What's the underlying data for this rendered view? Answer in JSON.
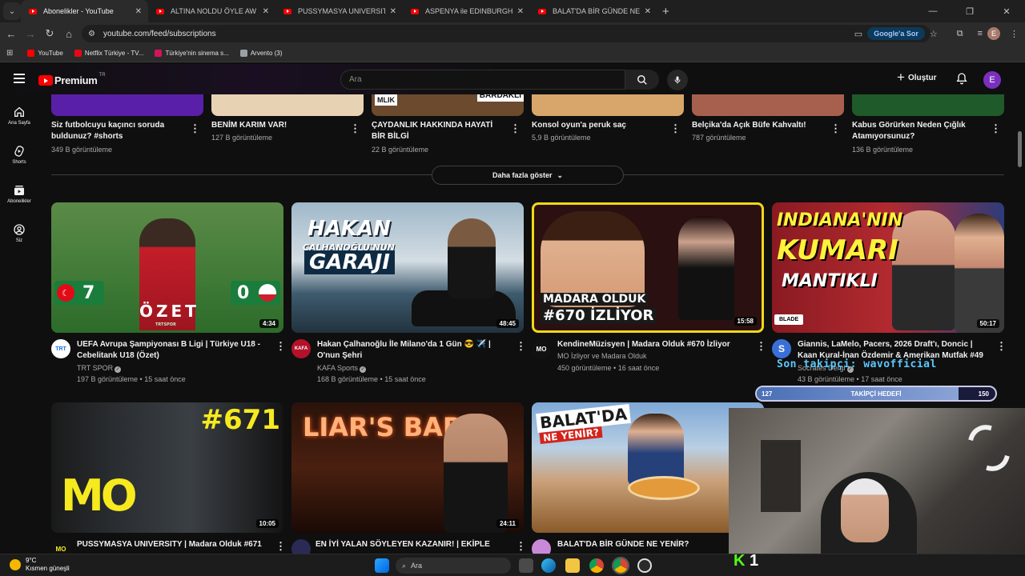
{
  "browser": {
    "tabs": [
      {
        "label": "Abonelikler - YouTube",
        "active": true
      },
      {
        "label": "ALTINA NOLDU ÖYLE AW | Kan",
        "active": false
      },
      {
        "label": "PUSSYMASYA UNIVERSITY | Ma",
        "active": false
      },
      {
        "label": "ASPENYA ile EDINBURGH YEME",
        "active": false
      },
      {
        "label": "BALAT'DA BİR GÜNDE NE YENİR",
        "active": false
      }
    ],
    "url": "youtube.com/feed/subscriptions",
    "google_sor_label": "Google'a Sor",
    "profile_initial": "E",
    "bookmarks": [
      {
        "label": "YouTube",
        "color": "#ff0000"
      },
      {
        "label": "Netflix Türkiye - TV...",
        "color": "#e50914"
      },
      {
        "label": "Türkiye'nin sinema s...",
        "color": "#d4145a"
      },
      {
        "label": "Arvento (3)",
        "color": "#9aa0a6"
      }
    ]
  },
  "youtube": {
    "logo_text": "Premium",
    "logo_region": "TR",
    "search_placeholder": "Ara",
    "create_label": "Oluştur",
    "avatar_initial": "E",
    "sidebar": [
      {
        "label": "Ana Sayfa",
        "icon": "home-icon"
      },
      {
        "label": "Shorts",
        "icon": "shorts-icon"
      },
      {
        "label": "Abonelikler",
        "icon": "subscriptions-icon"
      },
      {
        "label": "Siz",
        "icon": "you-icon"
      }
    ],
    "shorts": [
      {
        "title": "Siz futbolcuyu kaçıncı soruda buldunuz? #shorts",
        "views": "349 B görüntüleme",
        "color": "#5a1fa8"
      },
      {
        "title": "BENİM KARIM VAR!",
        "views": "127 B görüntüleme",
        "color": "#e8d2b4"
      },
      {
        "title": "ÇAYDANLIK HAKKINDA HAYATİ BİR BİLGİ",
        "views": "22 B görüntüleme",
        "color": "#6b4a2e",
        "thumb_left": "MLIK",
        "thumb_right": "BARDAKLI"
      },
      {
        "title": "Konsol oyun'a peruk saç",
        "views": "5,9 B görüntüleme",
        "color": "#d8a66a"
      },
      {
        "title": "Belçika'da Açık Büfe Kahvaltı!",
        "views": "787 görüntüleme",
        "color": "#a8604e"
      },
      {
        "title": "Kabus Görürken Neden Çığlık Atamıyorsunuz?",
        "views": "136 B görüntüleme",
        "color": "#1f5a2a"
      }
    ],
    "more_button": "Daha fazla göster",
    "videos_row1": [
      {
        "title": "UEFA Avrupa Şampiyonası B Ligi | Türkiye U18 - Cebelitank U18 (Özet)",
        "channel": "TRT SPOR",
        "verified": true,
        "meta": "197 B görüntüleme • 15 saat önce",
        "duration": "4:34",
        "avatar": "TRT",
        "avatar_bg": "#ffffff",
        "avatar_fg": "#1a73e8",
        "thumb": {
          "score_left": "7",
          "score_right": "0",
          "caption": "ÖZET",
          "brand": "TRTSPOR"
        }
      },
      {
        "title": "Hakan Çalhanoğlu İle Milano'da 1 Gün 😎 ✈️ | O'nun Şehri",
        "channel": "KAFA Sports",
        "verified": true,
        "meta": "168 B görüntüleme • 15 saat önce",
        "duration": "48:45",
        "avatar": "KAFA",
        "avatar_bg": "#b3122a",
        "avatar_fg": "#ffffff",
        "thumb": {
          "line1": "HAKAN",
          "line2": "ÇALHANOĞLU'NUN",
          "line3": "GARAJI"
        }
      },
      {
        "title": "KendineMüzisyen | Madara Olduk #670 İzliyor",
        "channel": "MO İzliyor ve Madara Olduk",
        "verified": false,
        "meta": "450 görüntüleme • 16 saat önce",
        "duration": "15:58",
        "avatar": "MO",
        "avatar_bg": "#111111",
        "avatar_fg": "#ffffff",
        "thumb": {
          "line1": "MADARA OLDUK",
          "line2": "#670 İZLİYOR"
        }
      },
      {
        "title": "Giannis, LaMelo, Pacers, 2026 Draft'ı, Doncic | Kaan Kural-İnan Özdemir & Amerikan Mutfak #49",
        "channel": "Socrates Dergi",
        "verified": true,
        "meta": "43 B görüntüleme • 17 saat önce",
        "duration": "50:17",
        "avatar": "S",
        "avatar_bg": "#3b6fd8",
        "avatar_fg": "#ffffff",
        "thumb": {
          "line1": "INDIANA'NIN",
          "line2": "KUMARI",
          "line3": "MANTIKLI",
          "brand": "BLADE"
        }
      }
    ],
    "videos_row2": [
      {
        "title": "PUSSYMASYA UNIVERSITY | Madara Olduk #671",
        "duration": "10:05",
        "avatar": "MO",
        "avatar_bg": "#111111",
        "thumb": {
          "badge": "#671",
          "logo": "MO"
        }
      },
      {
        "title": "EN İYİ YALAN SÖYLEYEN KAZANIR! | EKİPLE",
        "duration": "24:11",
        "avatar": "",
        "avatar_bg": "#2a2a55",
        "thumb": {
          "neon": "LIAR'S BAR"
        }
      },
      {
        "title": "BALAT'DA BİR GÜNDE NE YENİR?",
        "duration": "",
        "avatar": "",
        "avatar_bg": "#c88ad8",
        "thumb": {
          "line1": "BALAT'DA",
          "line2": "NE YENİR?"
        }
      }
    ]
  },
  "stream_overlay": {
    "follower_text": "Son takipçi: wavofficial",
    "goal_label": "TAKİPÇİ HEDEFİ",
    "goal_current": "127",
    "goal_target": "150",
    "goal_progress": 0.847,
    "kick_count": "1"
  },
  "taskbar": {
    "temperature": "9°C",
    "weather": "Kısmen güneşli",
    "search_placeholder": "Ara"
  }
}
